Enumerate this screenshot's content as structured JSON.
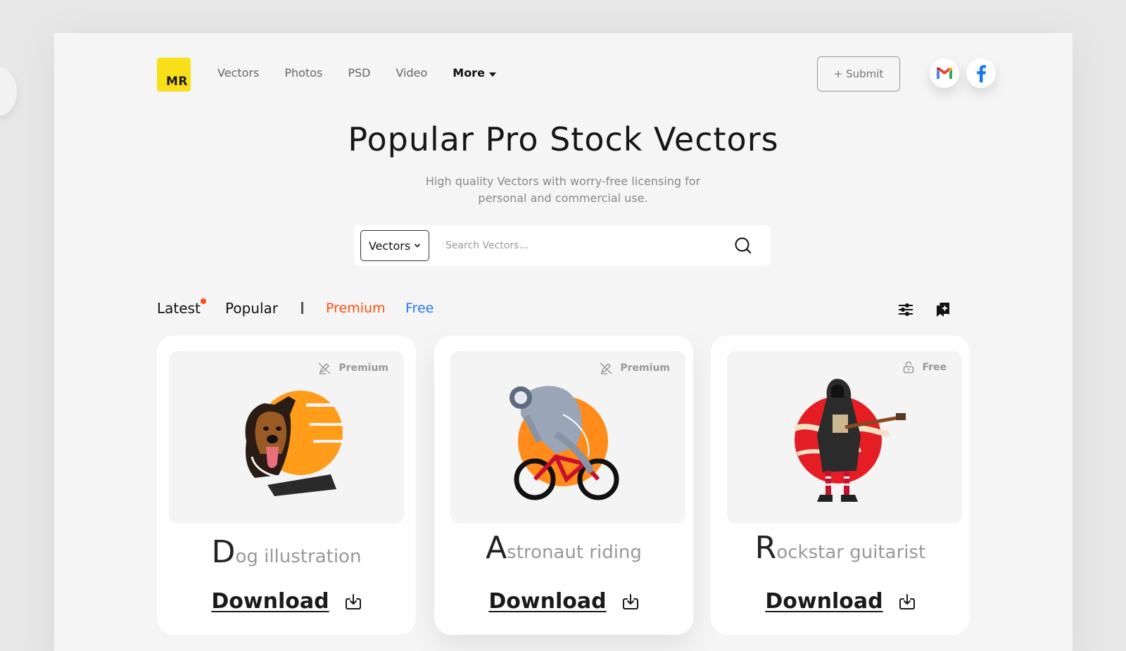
{
  "header": {
    "logo_text": "MR",
    "nav": [
      {
        "label": "Vectors"
      },
      {
        "label": "Photos"
      },
      {
        "label": "PSD"
      },
      {
        "label": "Video"
      }
    ],
    "more_label": "More",
    "submit_label": "+ Submit",
    "social": [
      "gmail-icon",
      "facebook-icon"
    ]
  },
  "hero": {
    "title": "Popular Pro Stock Vectors",
    "subtitle": "High quality Vectors with worry-free licensing for personal and commercial use."
  },
  "search": {
    "category": "Vectors",
    "placeholder": "Search Vectors..."
  },
  "filters": {
    "tabs": [
      {
        "label": "Latest",
        "has_dot": true
      },
      {
        "label": "Popular"
      },
      {
        "label": "Premium",
        "color": "#ff4e0e"
      },
      {
        "label": "Free",
        "color": "#1f7bf2"
      }
    ]
  },
  "cards": [
    {
      "badge": "Premium",
      "badge_icon": "pen-slash-icon",
      "initial": "D",
      "rest": "og illustration",
      "download_label": "Download"
    },
    {
      "badge": "Premium",
      "badge_icon": "pen-slash-icon",
      "initial": "A",
      "rest": "stronaut riding",
      "download_label": "Download"
    },
    {
      "badge": "Free",
      "badge_icon": "unlock-icon",
      "initial": "R",
      "rest": "ockstar guitarist",
      "download_label": "Download"
    }
  ],
  "colors": {
    "brand_yellow": "#f8df1a",
    "premium": "#ff4e0e",
    "free": "#1f7bf2",
    "accent_orange": "#ff9c1a",
    "rockstar_red": "#e51e25"
  }
}
